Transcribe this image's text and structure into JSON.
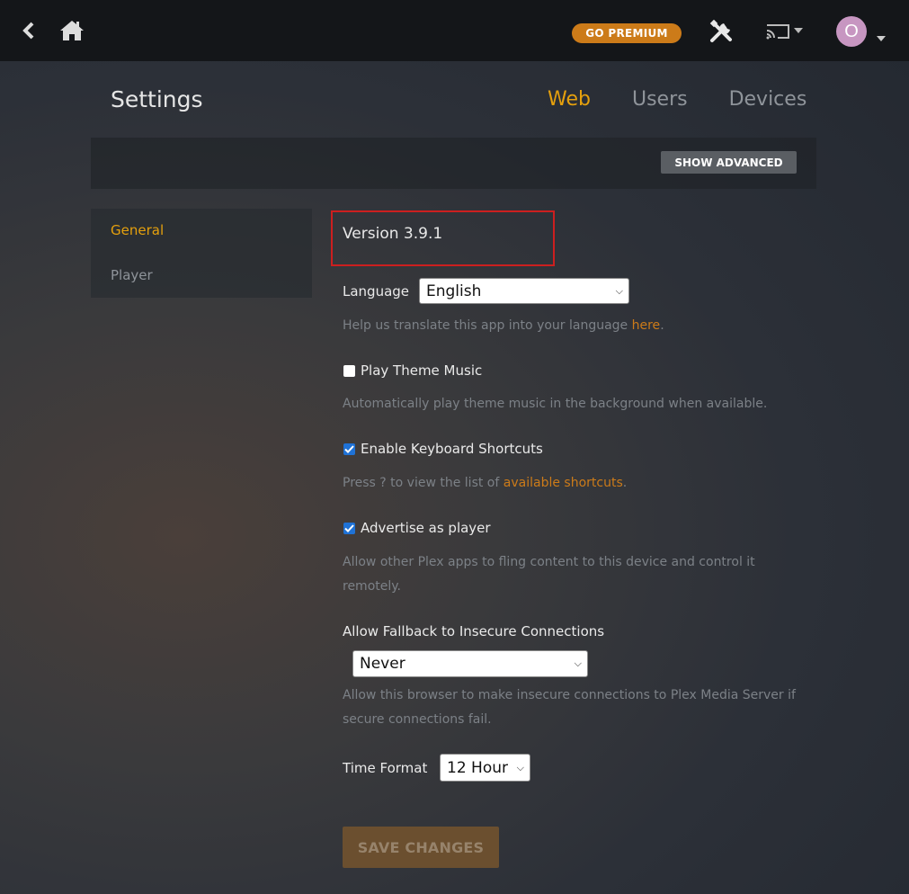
{
  "topbar": {
    "premium_label": "GO PREMIUM",
    "avatar_letter": "O"
  },
  "header": {
    "title": "Settings",
    "tabs": [
      {
        "label": "Web"
      },
      {
        "label": "Users"
      },
      {
        "label": "Devices"
      }
    ],
    "show_advanced_label": "SHOW ADVANCED"
  },
  "sidebar": {
    "items": [
      {
        "label": "General"
      },
      {
        "label": "Player"
      }
    ]
  },
  "main": {
    "version": "Version 3.9.1",
    "language": {
      "label": "Language",
      "value": "English",
      "help_prefix": "Help us translate this app into your language ",
      "help_link": "here",
      "help_suffix": "."
    },
    "theme_music": {
      "label": "Play Theme Music",
      "checked": false,
      "help": "Automatically play theme music in the background when available."
    },
    "keyboard": {
      "label": "Enable Keyboard Shortcuts",
      "checked": true,
      "help_prefix": "Press ? to view the list of ",
      "help_link": "available shortcuts",
      "help_suffix": "."
    },
    "advertise": {
      "label": "Advertise as player",
      "checked": true,
      "help_line1": "Allow other Plex apps to fling content to this device and control it",
      "help_line2": "remotely."
    },
    "fallback": {
      "label": "Allow Fallback to Insecure Connections",
      "value": "Never",
      "help_line1": "Allow this browser to make insecure connections to Plex Media Server if",
      "help_line2": "secure connections fail."
    },
    "time_format": {
      "label": "Time Format",
      "value": "12 Hour"
    },
    "save_label": "SAVE CHANGES"
  },
  "colors": {
    "accent": "#e5a00d",
    "premium": "#cc7b19",
    "link": "#cc7b19",
    "highlight_box": "#cc1f1f",
    "checkbox_checked": "#1f72d6"
  }
}
